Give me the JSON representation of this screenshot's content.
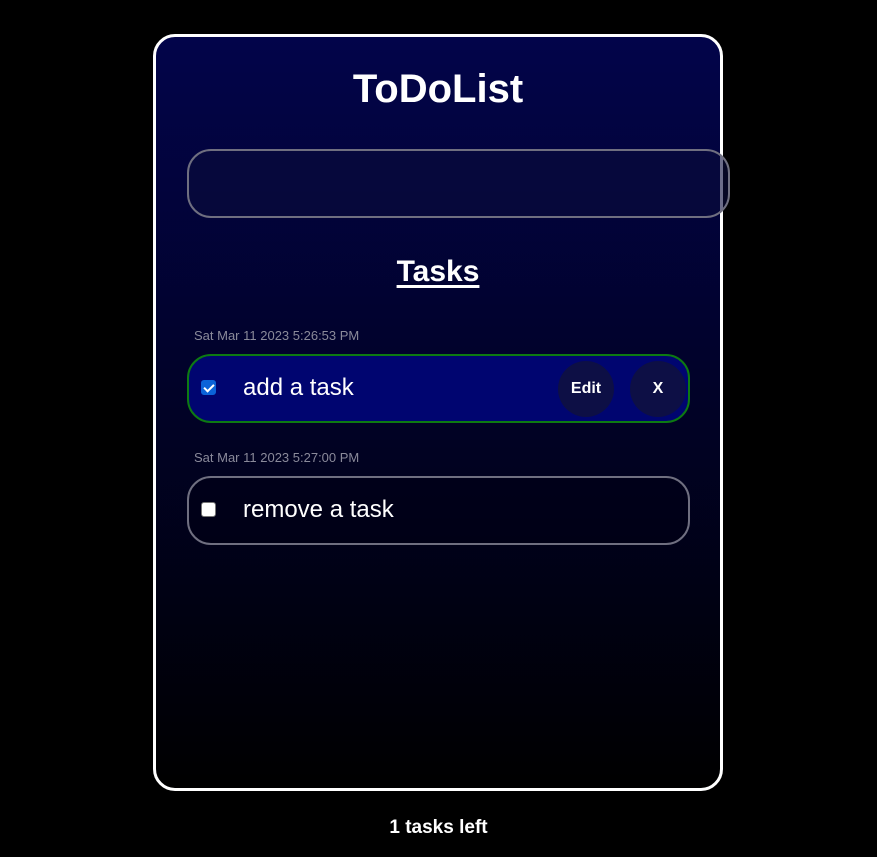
{
  "app": {
    "title": "ToDoList"
  },
  "new_task_input": {
    "value": "",
    "placeholder": ""
  },
  "tasks_heading": "Tasks",
  "tasks": [
    {
      "timestamp": "Sat Mar 11 2023 5:26:53 PM",
      "text": "add a task",
      "completed": true,
      "edit_label": "Edit",
      "delete_label": "X"
    },
    {
      "timestamp": "Sat Mar 11 2023 5:27:00 PM",
      "text": "remove a task",
      "completed": false
    }
  ],
  "footer": {
    "tasks_left": "1 tasks left"
  },
  "colors": {
    "page_background": "#000000",
    "card_border": "#ffffff",
    "card_gradient_top": "#02044a",
    "completed_task_background": "#000570",
    "completed_task_border": "#0d7a12",
    "open_task_border": "#6f6f80",
    "checkbox_accent": "#0b63d8"
  }
}
